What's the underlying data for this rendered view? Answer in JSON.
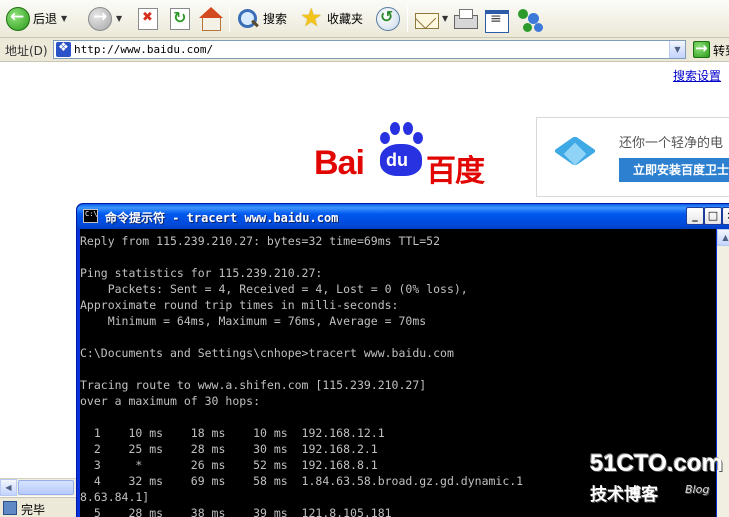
{
  "toolbar": {
    "back_label": "后退",
    "search_label": "搜索",
    "favorites_label": "收藏夹"
  },
  "address": {
    "label": "地址(D)",
    "url": "http://www.baidu.com/",
    "go_label": "转到"
  },
  "webpage": {
    "search_settings": "搜索设置",
    "logo_text": "Bai",
    "logo_paw_text": "du",
    "logo_cn": "百度",
    "ad_text": "还你一个轻净的电",
    "ad_button": "立即安装百度卫士"
  },
  "status": {
    "text": "完毕"
  },
  "cmd": {
    "title": "命令提示符 - tracert www.baidu.com",
    "lines": [
      "Reply from 115.239.210.27: bytes=32 time=69ms TTL=52",
      "",
      "Ping statistics for 115.239.210.27:",
      "    Packets: Sent = 4, Received = 4, Lost = 0 (0% loss),",
      "Approximate round trip times in milli-seconds:",
      "    Minimum = 64ms, Maximum = 76ms, Average = 70ms",
      "",
      "C:\\Documents and Settings\\cnhope>tracert www.baidu.com",
      "",
      "Tracing route to www.a.shifen.com [115.239.210.27]",
      "over a maximum of 30 hops:",
      "",
      "  1    10 ms    18 ms    10 ms  192.168.12.1",
      "  2    25 ms    28 ms    30 ms  192.168.2.1",
      "  3     *       26 ms    52 ms  192.168.8.1",
      "  4    32 ms    69 ms    58 ms  1.84.63.58.broad.gz.gd.dynamic.1",
      "8.63.84.1]",
      "  5    28 ms    38 ms    39 ms  121.8.105.181"
    ]
  },
  "watermark": {
    "main": "51CTO.com",
    "sub": "技术博客",
    "blog": "Blog"
  }
}
